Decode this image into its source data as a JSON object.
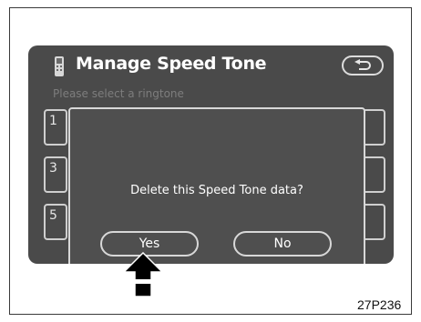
{
  "header": {
    "title": "Manage Speed Tone",
    "subtitle": "Please select a ringtone",
    "title_icon": "phone-handset-icon",
    "back_icon": "return-arrow-icon"
  },
  "slots": [
    {
      "label": "1"
    },
    {
      "label": "3"
    },
    {
      "label": "5"
    }
  ],
  "dialog": {
    "message": "Delete this Speed Tone data?",
    "yes_label": "Yes",
    "no_label": "No"
  },
  "pointer_icon": "up-arrow-icon",
  "figure_ref": "27P236",
  "colors": {
    "screen_bg": "#4a4a4a",
    "dialog_bg": "#4f4f4f",
    "outline": "#d8d8d8",
    "subtitle_text": "#7d7d7d"
  }
}
